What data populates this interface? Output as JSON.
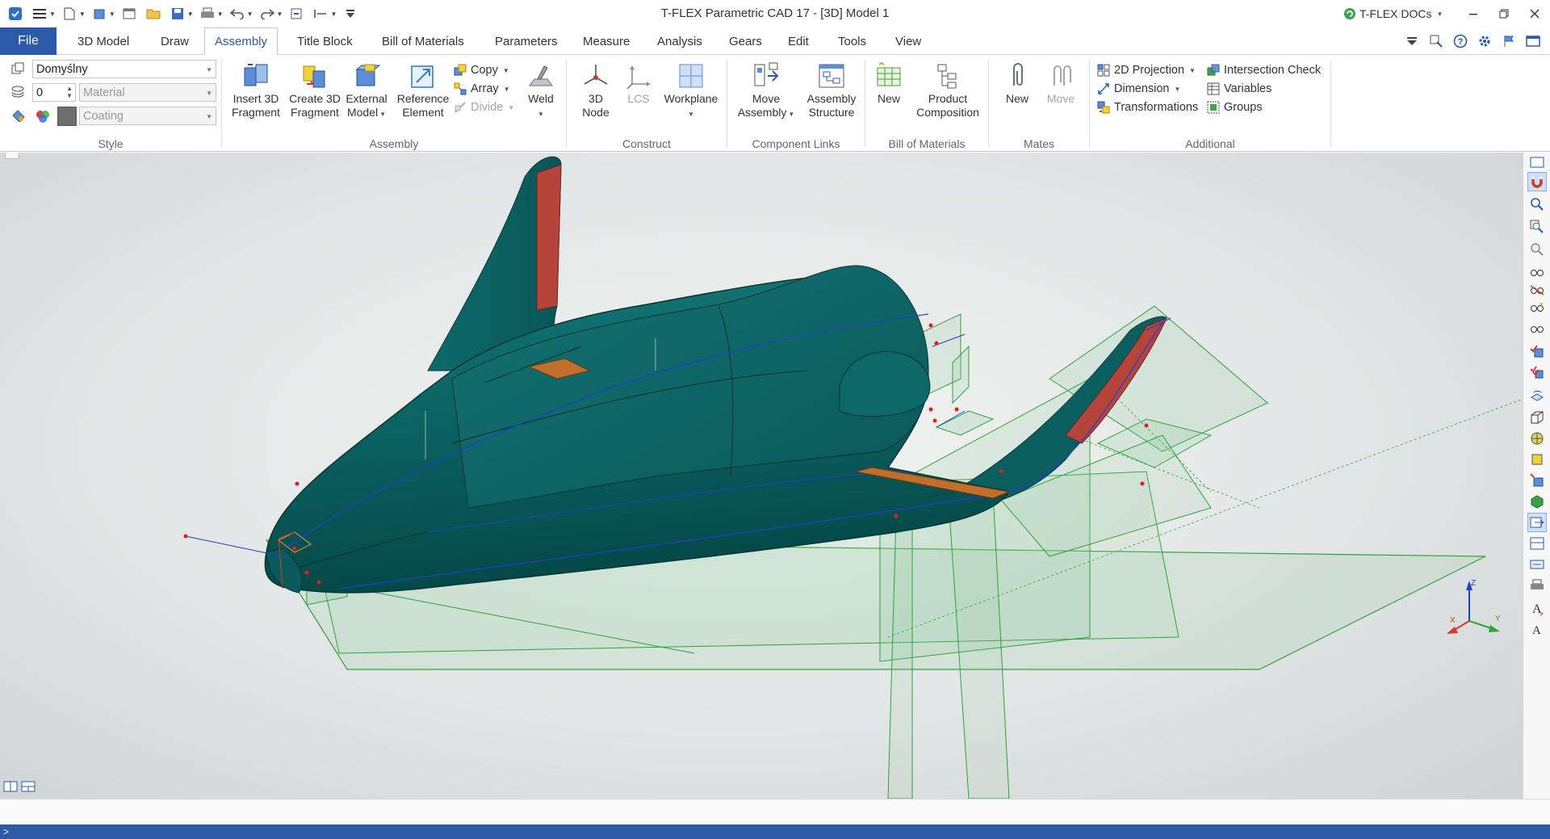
{
  "window": {
    "title": "T-FLEX Parametric CAD 17 - [3D] Model 1",
    "docs_label": "T-FLEX DOCs"
  },
  "tabs": {
    "file": "File",
    "items": [
      "3D Model",
      "Draw",
      "Assembly",
      "Title Block",
      "Bill of Materials",
      "Parameters",
      "Measure",
      "Analysis",
      "Gears",
      "Edit",
      "Tools",
      "View"
    ],
    "active": "Assembly"
  },
  "style_group": {
    "label": "Style",
    "style_value": "Domyślny",
    "layer_value": "0",
    "material_placeholder": "Material",
    "coating_placeholder": "Coating"
  },
  "assembly_group": {
    "label": "Assembly",
    "insert": "Insert 3D\nFragment",
    "insert_l1": "Insert 3D",
    "insert_l2": "Fragment",
    "create_l1": "Create 3D",
    "create_l2": "Fragment",
    "external_l1": "External",
    "external_l2": "Model",
    "reference_l1": "Reference",
    "reference_l2": "Element",
    "copy": "Copy",
    "array": "Array",
    "divide": "Divide",
    "weld": "Weld"
  },
  "construct_group": {
    "label": "Construct",
    "node_l1": "3D",
    "node_l2": "Node",
    "lcs": "LCS",
    "workplane": "Workplane"
  },
  "links_group": {
    "label": "Component Links",
    "move_l1": "Move",
    "move_l2": "Assembly",
    "structure_l1": "Assembly",
    "structure_l2": "Structure"
  },
  "bom_group": {
    "label": "Bill of Materials",
    "new": "New",
    "product_l1": "Product",
    "product_l2": "Composition"
  },
  "mates_group": {
    "label": "Mates",
    "new": "New",
    "move": "Move"
  },
  "additional_group": {
    "label": "Additional",
    "projection": "2D Projection",
    "dimension": "Dimension",
    "transformations": "Transformations",
    "intersection": "Intersection Check",
    "variables": "Variables",
    "groups": "Groups"
  },
  "axes": {
    "x": "X",
    "y": "Y",
    "z": "Z"
  },
  "command_prompt": ">",
  "colors": {
    "accent": "#2a5aa8",
    "body": "#0b5f5f",
    "fin_red": "#b5443b",
    "plane_green": "#4caf50"
  }
}
